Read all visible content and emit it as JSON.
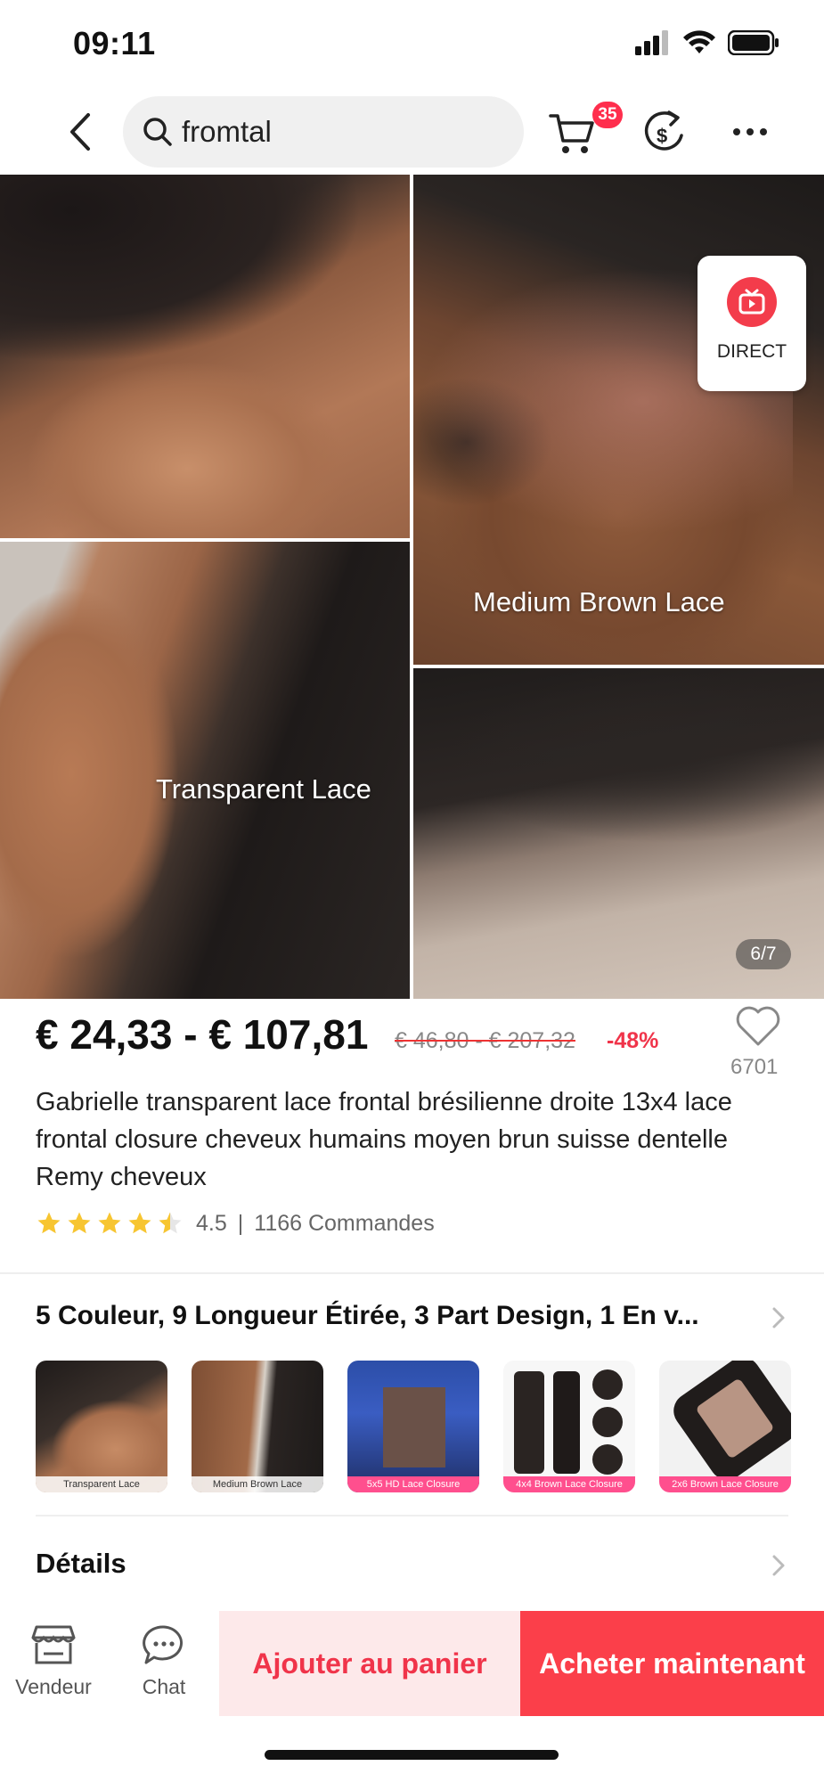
{
  "status_bar": {
    "time": "09:11"
  },
  "header": {
    "search_query": "fromtal",
    "cart_count": "35"
  },
  "gallery": {
    "labels": [
      "Transparent Lace",
      "Medium Brown Lace"
    ],
    "direct_label": "DIRECT",
    "page_indicator": "6/7"
  },
  "price": {
    "range": "€ 24,33 - € 107,81",
    "original_range": "€ 46,80 - € 207,32",
    "discount": "-48%",
    "wishlist_count": "6701"
  },
  "product": {
    "title": "Gabrielle transparent lace frontal brésilienne droite 13x4 lace frontal closure cheveux humains moyen brun suisse dentelle Remy cheveux",
    "rating": 4.5,
    "rating_text": "4.5",
    "separator": "|",
    "orders": "1166 Commandes"
  },
  "variants": {
    "summary": "5 Couleur, 9 Longueur Étirée, 3 Part Design, 1 En v...",
    "thumbnails": [
      {
        "label": "Transparent Lace"
      },
      {
        "label": "Medium Brown Lace"
      },
      {
        "label": "5x5 HD Lace Closure"
      },
      {
        "label": "4x4 Brown Lace Closure"
      },
      {
        "label": "2x6 Brown Lace Closure"
      }
    ]
  },
  "details": {
    "title": "Détails"
  },
  "bottom_bar": {
    "vendor_label": "Vendeur",
    "chat_label": "Chat",
    "add_to_cart": "Ajouter au panier",
    "buy_now": "Acheter maintenant"
  },
  "colors": {
    "accent_red": "#fb3f4a",
    "discount_red": "#f0344a",
    "star_yellow": "#f7c531",
    "cart_light": "#fde9ea"
  },
  "icons": [
    "back-icon",
    "search-icon",
    "cart-icon",
    "coupon-icon",
    "more-icon",
    "live-icon",
    "heart-icon",
    "star-icon",
    "chevron-right-icon",
    "store-icon",
    "chat-icon"
  ]
}
